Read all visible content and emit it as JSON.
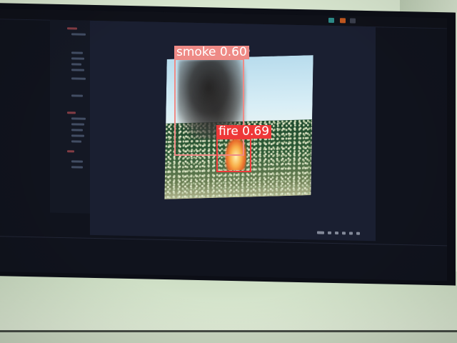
{
  "detections": [
    {
      "label": "smoke 0.60",
      "class": "smoke",
      "confidence": 0.6,
      "color": "#ee8a86"
    },
    {
      "label": "fire 0.69",
      "class": "fire",
      "confidence": 0.69,
      "color": "#ee3838"
    }
  ],
  "colors": {
    "screen_bg": "#10131d",
    "panel_bg": "#1a1f31",
    "wall": "#d8e6cf"
  },
  "icons": [
    "toolbar-icons",
    "bottom-toolbar-icons",
    "window-buttons"
  ]
}
